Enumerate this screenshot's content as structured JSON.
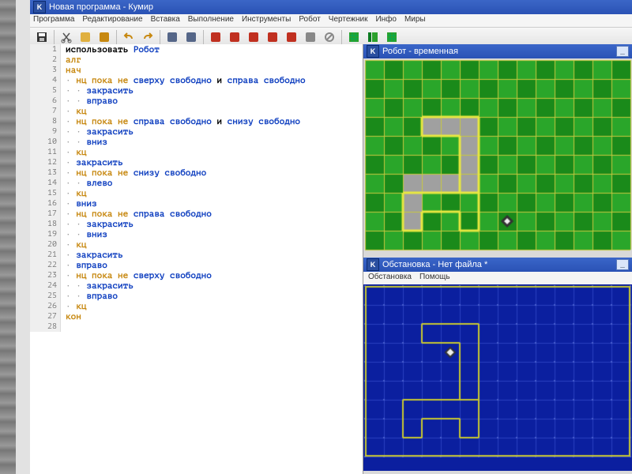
{
  "window": {
    "title": "Новая программа - Кумир",
    "icon_letter": "K"
  },
  "menu": {
    "items": [
      "Программа",
      "Редактирование",
      "Вставка",
      "Выполнение",
      "Инструменты",
      "Робот",
      "Чертежник",
      "Инфо",
      "Миры"
    ]
  },
  "toolbar": {
    "buttons": [
      {
        "name": "save",
        "fill": "#333"
      },
      {
        "sep": true
      },
      {
        "name": "cut",
        "fill": "#555"
      },
      {
        "name": "copy",
        "fill": "#e0b040"
      },
      {
        "name": "paste",
        "fill": "#c78810"
      },
      {
        "sep": true
      },
      {
        "name": "undo",
        "fill": "#c78810"
      },
      {
        "name": "redo",
        "fill": "#c78810"
      },
      {
        "sep": true
      },
      {
        "name": "doc1",
        "fill": "#568"
      },
      {
        "name": "doc2",
        "fill": "#568"
      },
      {
        "sep": true
      },
      {
        "name": "run-red",
        "fill": "#c03020"
      },
      {
        "name": "step-in",
        "fill": "#c03020"
      },
      {
        "name": "step-over",
        "fill": "#c03020"
      },
      {
        "name": "step-out",
        "fill": "#c03020"
      },
      {
        "name": "step",
        "fill": "#c03020"
      },
      {
        "name": "pause",
        "fill": "#888"
      },
      {
        "name": "stop",
        "fill": "#888"
      },
      {
        "sep": true
      },
      {
        "name": "grid-green",
        "fill": "#2ca02c"
      },
      {
        "name": "col-green",
        "fill": "#0a7a20"
      },
      {
        "name": "grid-green2",
        "fill": "#2ca02c"
      }
    ]
  },
  "code": {
    "lines": [
      {
        "n": 1,
        "tokens": [
          [
            "plain",
            "использовать "
          ],
          [
            "cmd",
            "Робот"
          ]
        ]
      },
      {
        "n": 2,
        "tokens": [
          [
            "kw",
            "алг"
          ]
        ]
      },
      {
        "n": 3,
        "tokens": [
          [
            "kw",
            "нач"
          ]
        ]
      },
      {
        "n": 4,
        "tokens": [
          [
            "bul",
            "· "
          ],
          [
            "kw",
            "нц пока не "
          ],
          [
            "cond",
            "сверху свободно"
          ],
          [
            "plain",
            " и "
          ],
          [
            "cond",
            "справа свободно"
          ]
        ]
      },
      {
        "n": 5,
        "tokens": [
          [
            "bul",
            "· · "
          ],
          [
            "cmd",
            "закрасить"
          ]
        ]
      },
      {
        "n": 6,
        "tokens": [
          [
            "bul",
            "· · "
          ],
          [
            "cmd",
            "вправо"
          ]
        ]
      },
      {
        "n": 7,
        "tokens": [
          [
            "bul",
            "· "
          ],
          [
            "kw",
            "кц"
          ]
        ]
      },
      {
        "n": 8,
        "tokens": [
          [
            "bul",
            "· "
          ],
          [
            "kw",
            "нц пока не "
          ],
          [
            "cond",
            "справа свободно"
          ],
          [
            "plain",
            " и "
          ],
          [
            "cond",
            "снизу свободно"
          ]
        ]
      },
      {
        "n": 9,
        "tokens": [
          [
            "bul",
            "· · "
          ],
          [
            "cmd",
            "закрасить"
          ]
        ]
      },
      {
        "n": 10,
        "tokens": [
          [
            "bul",
            "· · "
          ],
          [
            "cmd",
            "вниз"
          ]
        ]
      },
      {
        "n": 11,
        "tokens": [
          [
            "bul",
            "· "
          ],
          [
            "kw",
            "кц"
          ]
        ]
      },
      {
        "n": 12,
        "tokens": [
          [
            "bul",
            "· "
          ],
          [
            "cmd",
            "закрасить"
          ]
        ]
      },
      {
        "n": 13,
        "tokens": [
          [
            "bul",
            "· "
          ],
          [
            "kw",
            "нц пока не "
          ],
          [
            "cond",
            "снизу свободно"
          ]
        ]
      },
      {
        "n": 14,
        "tokens": [
          [
            "bul",
            "· · "
          ],
          [
            "cmd",
            "влево"
          ]
        ]
      },
      {
        "n": 15,
        "tokens": [
          [
            "bul",
            "· "
          ],
          [
            "kw",
            "кц"
          ]
        ]
      },
      {
        "n": 16,
        "tokens": [
          [
            "bul",
            "· "
          ],
          [
            "cmd",
            "вниз"
          ]
        ]
      },
      {
        "n": 17,
        "tokens": [
          [
            "bul",
            "· "
          ],
          [
            "kw",
            "нц пока не "
          ],
          [
            "cond",
            "справа свободно"
          ]
        ]
      },
      {
        "n": 18,
        "tokens": [
          [
            "bul",
            "· · "
          ],
          [
            "cmd",
            "закрасить"
          ]
        ]
      },
      {
        "n": 19,
        "tokens": [
          [
            "bul",
            "· · "
          ],
          [
            "cmd",
            "вниз"
          ]
        ]
      },
      {
        "n": 20,
        "tokens": [
          [
            "bul",
            "· "
          ],
          [
            "kw",
            "кц"
          ]
        ]
      },
      {
        "n": 21,
        "tokens": [
          [
            "bul",
            "· "
          ],
          [
            "cmd",
            "закрасить"
          ]
        ]
      },
      {
        "n": 22,
        "tokens": [
          [
            "bul",
            "· "
          ],
          [
            "cmd",
            "вправо"
          ]
        ]
      },
      {
        "n": 23,
        "tokens": [
          [
            "bul",
            "· "
          ],
          [
            "kw",
            "нц пока не "
          ],
          [
            "cond",
            "сверху свободно"
          ]
        ]
      },
      {
        "n": 24,
        "tokens": [
          [
            "bul",
            "· · "
          ],
          [
            "cmd",
            "закрасить"
          ]
        ]
      },
      {
        "n": 25,
        "tokens": [
          [
            "bul",
            "· · "
          ],
          [
            "cmd",
            "вправо"
          ]
        ]
      },
      {
        "n": 26,
        "tokens": [
          [
            "bul",
            "· "
          ],
          [
            "kw",
            "кц"
          ]
        ]
      },
      {
        "n": 27,
        "tokens": [
          [
            "kw",
            "кон"
          ]
        ]
      },
      {
        "n": 28,
        "tokens": []
      }
    ]
  },
  "robot_panel": {
    "title": "Робот - временная",
    "icon_letter": "K",
    "grid": {
      "cols": 14,
      "rows": 10,
      "cell": 24,
      "bg_dark": "#1a8a1a",
      "bg_light": "#2aa62a",
      "line": "#c8c840",
      "painted_color": "#a0a0a0",
      "painted": [
        [
          3,
          3
        ],
        [
          4,
          3
        ],
        [
          5,
          3
        ],
        [
          5,
          4
        ],
        [
          5,
          5
        ],
        [
          5,
          6
        ],
        [
          4,
          6
        ],
        [
          3,
          6
        ],
        [
          2,
          6
        ],
        [
          2,
          7
        ],
        [
          2,
          8
        ]
      ],
      "walls": [
        [
          3,
          3,
          6,
          3
        ],
        [
          6,
          3,
          6,
          4
        ],
        [
          3,
          3,
          3,
          4
        ],
        [
          3,
          4,
          5,
          4
        ],
        [
          5,
          4,
          5,
          7
        ],
        [
          6,
          4,
          6,
          7
        ],
        [
          2,
          7,
          6,
          7
        ],
        [
          2,
          7,
          2,
          9
        ],
        [
          3,
          8,
          3,
          9
        ],
        [
          5,
          8,
          5,
          9
        ],
        [
          3,
          8,
          5,
          8
        ],
        [
          6,
          7,
          6,
          9
        ],
        [
          2,
          9,
          3,
          9
        ],
        [
          5,
          9,
          6,
          9
        ]
      ],
      "robot": [
        7,
        8
      ]
    }
  },
  "setup_panel": {
    "title": "Обстановка - Нет файла *",
    "icon_letter": "K",
    "menu": [
      "Обстановка",
      "Помощь"
    ],
    "grid": {
      "cols": 14,
      "rows": 9,
      "cell": 24,
      "bg": "#0b1f9f",
      "line_minor": "#2a3fbf",
      "line_major": "#c8c830",
      "walls": [
        [
          3,
          2,
          6,
          2
        ],
        [
          6,
          2,
          6,
          3
        ],
        [
          3,
          2,
          3,
          3
        ],
        [
          3,
          3,
          5,
          3
        ],
        [
          5,
          3,
          5,
          6
        ],
        [
          6,
          3,
          6,
          6
        ],
        [
          2,
          6,
          6,
          6
        ],
        [
          2,
          6,
          2,
          8
        ],
        [
          3,
          7,
          3,
          8
        ],
        [
          5,
          7,
          5,
          8
        ],
        [
          3,
          7,
          5,
          7
        ],
        [
          6,
          6,
          6,
          8
        ],
        [
          2,
          8,
          3,
          8
        ],
        [
          5,
          8,
          6,
          8
        ]
      ],
      "robot": [
        4,
        3
      ]
    }
  }
}
